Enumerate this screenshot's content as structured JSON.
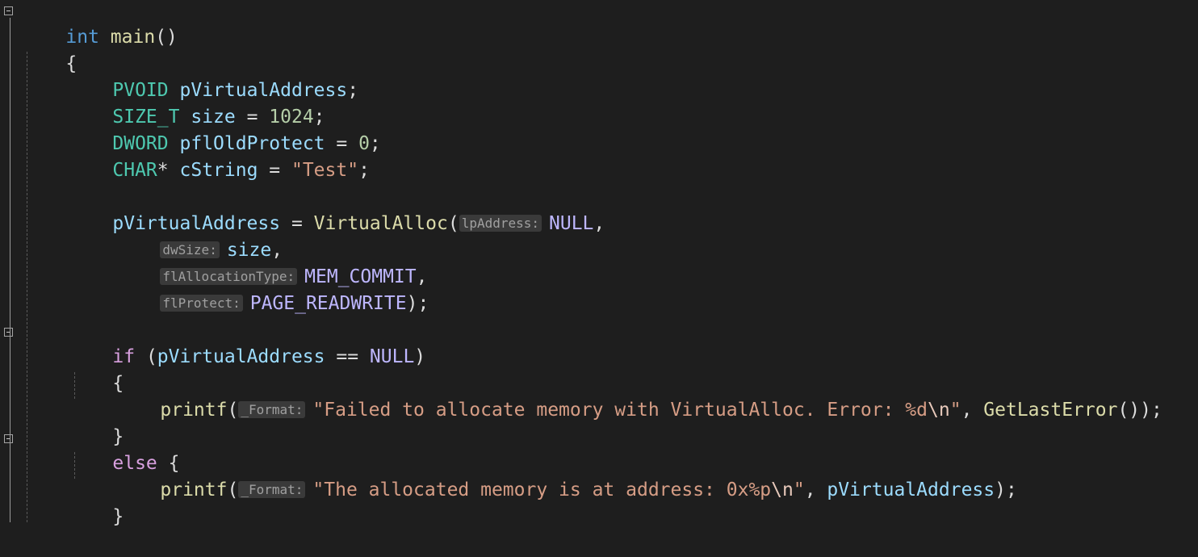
{
  "code": {
    "l1": {
      "kw": "int",
      "fn": "main",
      "rest": "()"
    },
    "l2": {
      "brace": "{"
    },
    "l3": {
      "type": "PVOID",
      "var": "pVirtualAddress",
      "rest": ";"
    },
    "l4": {
      "type": "SIZE_T",
      "var": "size",
      "op": " = ",
      "num": "1024",
      "rest": ";"
    },
    "l5": {
      "type": "DWORD",
      "var": "pflOldProtect",
      "op": " = ",
      "num": "0",
      "rest": ";"
    },
    "l6": {
      "type": "CHAR",
      "star": "*",
      "var": "cString",
      "op": " = ",
      "str": "\"Test\"",
      "rest": ";"
    },
    "l7": {
      "var": "pVirtualAddress",
      "op": " = ",
      "fn": "VirtualAlloc",
      "paren": "(",
      "hint": "lpAddress:",
      "mac": "NULL",
      "rest": ","
    },
    "l8": {
      "hint": "dwSize:",
      "var": "size",
      "rest": ","
    },
    "l9": {
      "hint": "flAllocationType:",
      "mac": "MEM_COMMIT",
      "rest": ","
    },
    "l10": {
      "hint": "flProtect:",
      "mac": "PAGE_READWRITE",
      "rest": ");"
    },
    "l11": {
      "ctl": "if",
      "paren": " (",
      "var": "pVirtualAddress",
      "op": " == ",
      "mac": "NULL",
      "rest": ")"
    },
    "l12": {
      "brace": "{"
    },
    "l13": {
      "fn": "printf",
      "paren": "(",
      "hint": "_Format:",
      "str": "\"Failed to allocate memory with VirtualAlloc. Error: %d",
      "esc": "\\n",
      "str2": "\"",
      "comma": ", ",
      "fn2": "GetLastError",
      "rest": "());"
    },
    "l14": {
      "brace": "}"
    },
    "l15": {
      "ctl": "else",
      "rest": " {"
    },
    "l16": {
      "fn": "printf",
      "paren": "(",
      "hint": "_Format:",
      "str": "\"The allocated memory is at address: 0x%p",
      "esc": "\\n",
      "str2": "\"",
      "comma": ", ",
      "var": "pVirtualAddress",
      "rest": ");"
    },
    "l17": {
      "brace": "}"
    }
  },
  "colors": {
    "background": "#1e1e1e",
    "keyword": "#569cd6",
    "control": "#d8a0df",
    "type": "#4ec9b0",
    "variable": "#9cdcfe",
    "number": "#b5cea8",
    "string": "#d69d85",
    "function": "#dcdcaa",
    "macro": "#beb7ff",
    "inlay_hint_bg": "#3a3a3a"
  }
}
